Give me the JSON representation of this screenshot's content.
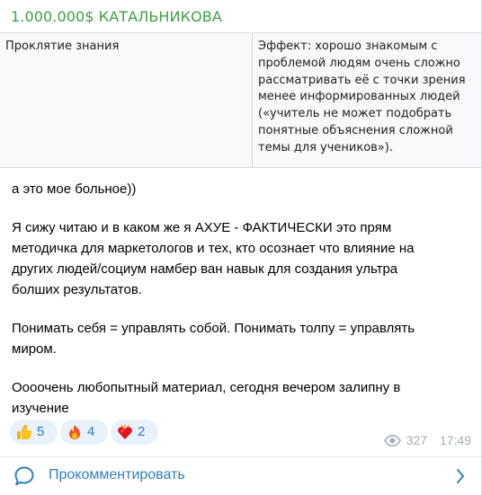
{
  "channel": {
    "name": "1.000.000$ КАТАЛЬНИКОВА",
    "name_color": "#3aa340"
  },
  "table_image": {
    "term": "Проклятие знания",
    "effect_lines": [
      "Эффект: хорошо знакомым с",
      "проблемой людям очень сложно",
      "рассматривать её с точки зрения",
      "менее информированных людей",
      "(«учитель не может подобрать",
      "понятные объяснения сложной",
      "темы для учеников»)."
    ]
  },
  "message": {
    "paragraphs": [
      [
        "а это мое больное))"
      ],
      [
        "Я сижу читаю и в каком же я АХУЕ - ФАКТИЧЕСКИ это прям",
        "методичка для маркетологов и тех, кто осознает что влияние на",
        "других людей/социум намбер ван навык для создания ультра",
        "болших результатов."
      ],
      [
        "Понимать себя = управлять собой. Понимать толпу = управлять",
        "миром."
      ],
      [
        "Оооочень любопытный материал, сегодня вечером залипну в",
        "изучение"
      ]
    ]
  },
  "reactions": [
    {
      "icon": "thumbs-up-icon",
      "count": "5"
    },
    {
      "icon": "fire-icon",
      "count": "4"
    },
    {
      "icon": "heart-on-fire-icon",
      "count": "2"
    }
  ],
  "meta": {
    "views": "327",
    "time": "17:49"
  },
  "comment": {
    "label": "Прокомментировать",
    "accent": "#2e7fc3"
  }
}
